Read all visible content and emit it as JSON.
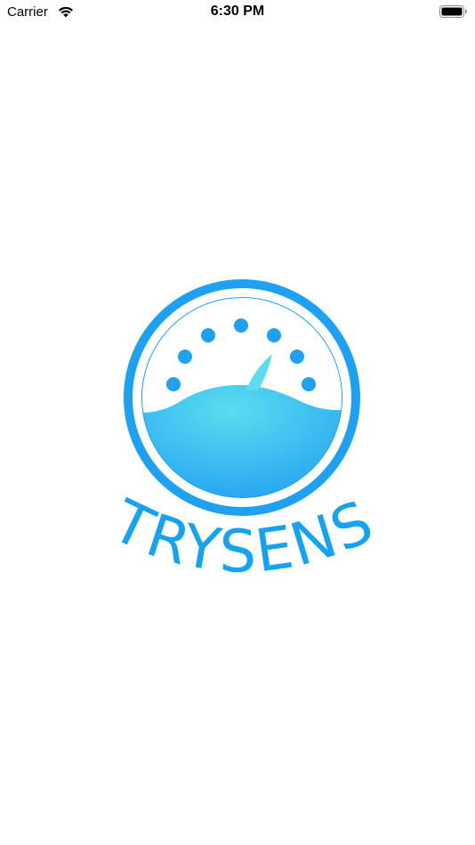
{
  "status_bar": {
    "carrier": "Carrier",
    "time": "6:30 PM",
    "wifi_icon": "wifi-icon",
    "battery_icon": "battery-icon"
  },
  "splash": {
    "logo_icon": "gauge-logo-icon",
    "brand_name": "TRYSENS",
    "colors": {
      "ring": "#1EA1F2",
      "wave_top": "#5ADDF0",
      "wave_bottom": "#1E9BF2",
      "text": "#14A3F3",
      "background": "#FFFFFF"
    }
  }
}
